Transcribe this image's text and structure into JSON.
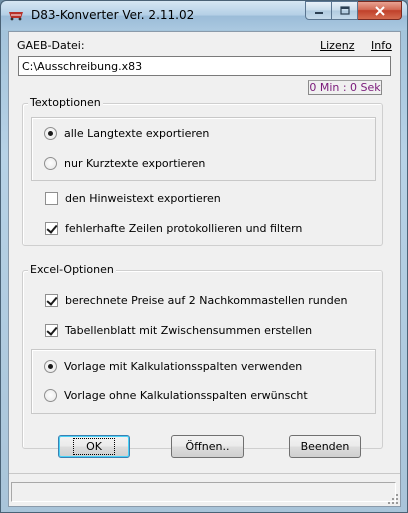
{
  "window": {
    "title": "D83-Konverter Ver. 2.11.02",
    "icon": "d83-app-icon",
    "controls": [
      "minimize-icon",
      "maximize-icon",
      "close-icon"
    ]
  },
  "file": {
    "label": "GAEB-Datei:",
    "value": "C:\\Ausschreibung.x83"
  },
  "menu": {
    "license": "Lizenz",
    "info": "Info"
  },
  "timer": "0 Min : 0 Sek",
  "text_options": {
    "title": "Textoptionen",
    "radio_all_long": {
      "label": "alle Langtexte exportieren",
      "selected": true
    },
    "radio_short_only": {
      "label": "nur Kurztexte exportieren",
      "selected": false
    },
    "check_hint_text": {
      "label": "den Hinweistext exportieren",
      "checked": false
    },
    "check_faulty_lines": {
      "label": "fehlerhafte Zeilen protokollieren und filtern",
      "checked": true
    }
  },
  "excel_options": {
    "title": "Excel-Optionen",
    "check_round_prices": {
      "label": "berechnete Preise auf 2 Nachkommastellen runden",
      "checked": true
    },
    "check_subtotal_sheet": {
      "label": "Tabellenblatt mit Zwischensummen erstellen",
      "checked": true
    },
    "radio_with_calc_cols": {
      "label": "Vorlage mit Kalkulationsspalten verwenden",
      "selected": true
    },
    "radio_without_calc_cols": {
      "label": "Vorlage ohne Kalkulationsspalten erwünscht",
      "selected": false
    }
  },
  "buttons": {
    "ok": "OK",
    "open": "Öffnen..",
    "exit": "Beenden"
  },
  "status": ""
}
